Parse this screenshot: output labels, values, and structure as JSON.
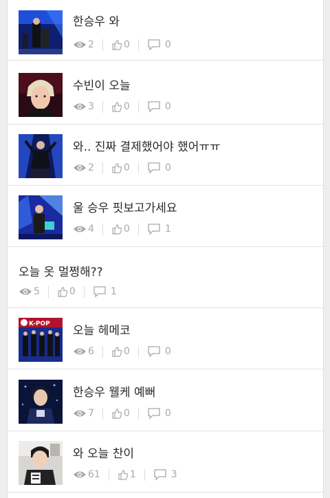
{
  "posts": [
    {
      "title": "한승우 와",
      "views": "2",
      "likes": "0",
      "comments": "0",
      "has_thumb": true,
      "thumb": "stage-blue"
    },
    {
      "title": "수빈이 오늘",
      "views": "3",
      "likes": "0",
      "comments": "0",
      "has_thumb": true,
      "thumb": "face-closeup"
    },
    {
      "title": "와.. 진짜 결제했어야 했어ㅠㅠ",
      "views": "2",
      "likes": "0",
      "comments": "0",
      "has_thumb": true,
      "thumb": "stage-dance"
    },
    {
      "title": "울 승우 핏보고가세요",
      "views": "4",
      "likes": "0",
      "comments": "1",
      "has_thumb": true,
      "thumb": "stage-award"
    },
    {
      "title": "오늘 옷 멀쩡해??",
      "views": "5",
      "likes": "0",
      "comments": "1",
      "has_thumb": false
    },
    {
      "title": "오늘 헤메코",
      "views": "6",
      "likes": "0",
      "comments": "0",
      "has_thumb": true,
      "thumb": "kpop-group",
      "thumb_text": "K-POP"
    },
    {
      "title": "한승우 웰케 예뻐",
      "views": "7",
      "likes": "0",
      "comments": "0",
      "has_thumb": true,
      "thumb": "portrait-dark"
    },
    {
      "title": "와 오늘 찬이",
      "views": "61",
      "likes": "1",
      "comments": "3",
      "has_thumb": true,
      "thumb": "selfie-room"
    }
  ],
  "icons": {
    "views": "eye-icon",
    "likes": "thumbs-up-icon",
    "comments": "comment-icon"
  },
  "colors": {
    "meta": "#a8a8a8",
    "title": "#2a2a2a",
    "divider": "#e2e2e2"
  }
}
